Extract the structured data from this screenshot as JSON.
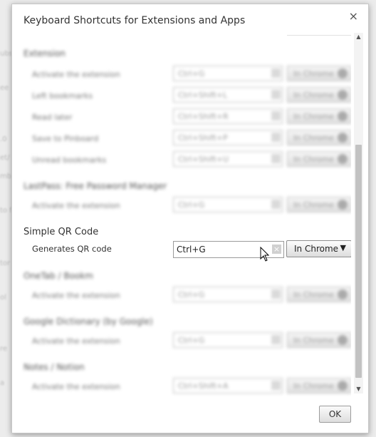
{
  "background_fragments": [
    "ubs",
    "ee",
    ".0",
    "et/",
    "mb",
    "to f",
    "tor",
    "ol",
    "re",
    "a"
  ],
  "dialog": {
    "title": "Keyboard Shortcuts for Extensions and Apps",
    "close_glyph": "×",
    "ok_label": "OK"
  },
  "extensions_top": [
    {
      "name": "Extension",
      "commands": [
        {
          "label": "Activate the extension",
          "shortcut": "Ctrl+G",
          "scope": "In Chrome"
        },
        {
          "label": "Left bookmarks",
          "shortcut": "Ctrl+Shift+L",
          "scope": "In Chrome"
        },
        {
          "label": "Read later",
          "shortcut": "Ctrl+Shift+R",
          "scope": "In Chrome"
        },
        {
          "label": "Save to Pinboard",
          "shortcut": "Ctrl+Shift+P",
          "scope": "In Chrome"
        },
        {
          "label": "Unread bookmarks",
          "shortcut": "Ctrl+Shift+U",
          "scope": "In Chrome"
        }
      ]
    },
    {
      "name": "LastPass: Free Password Manager",
      "commands": [
        {
          "label": "Activate the extension",
          "shortcut": "Ctrl+G",
          "scope": "In Chrome"
        }
      ]
    }
  ],
  "focused_extension": {
    "name": "Simple QR Code",
    "command_label": "Generates QR code",
    "shortcut": "Ctrl+G",
    "clear_glyph": "×",
    "scope": "In Chrome",
    "scope_arrow": "▼"
  },
  "extensions_bottom": [
    {
      "name": "OneTab / Bookm",
      "commands": [
        {
          "label": "Activate the extension",
          "shortcut": "Ctrl+G",
          "scope": "In Chrome"
        }
      ]
    },
    {
      "name": "Google Dictionary (by Google)",
      "commands": [
        {
          "label": "Activate the extension",
          "shortcut": "Ctrl+G",
          "scope": "In Chrome"
        }
      ]
    },
    {
      "name": "Notes / Notion",
      "commands": [
        {
          "label": "Activate the extension",
          "shortcut": "Ctrl+Shift+A",
          "scope": "In Chrome"
        }
      ]
    }
  ],
  "scrollbar": {
    "up_glyph": "▲",
    "down_glyph": "▼",
    "thumb_start": 0.3,
    "thumb_length": 0.68
  },
  "colors": {
    "dialog_bg": "#ffffff",
    "page_bg": "#ececec",
    "scroll_thumb": "#c2c2c2"
  }
}
